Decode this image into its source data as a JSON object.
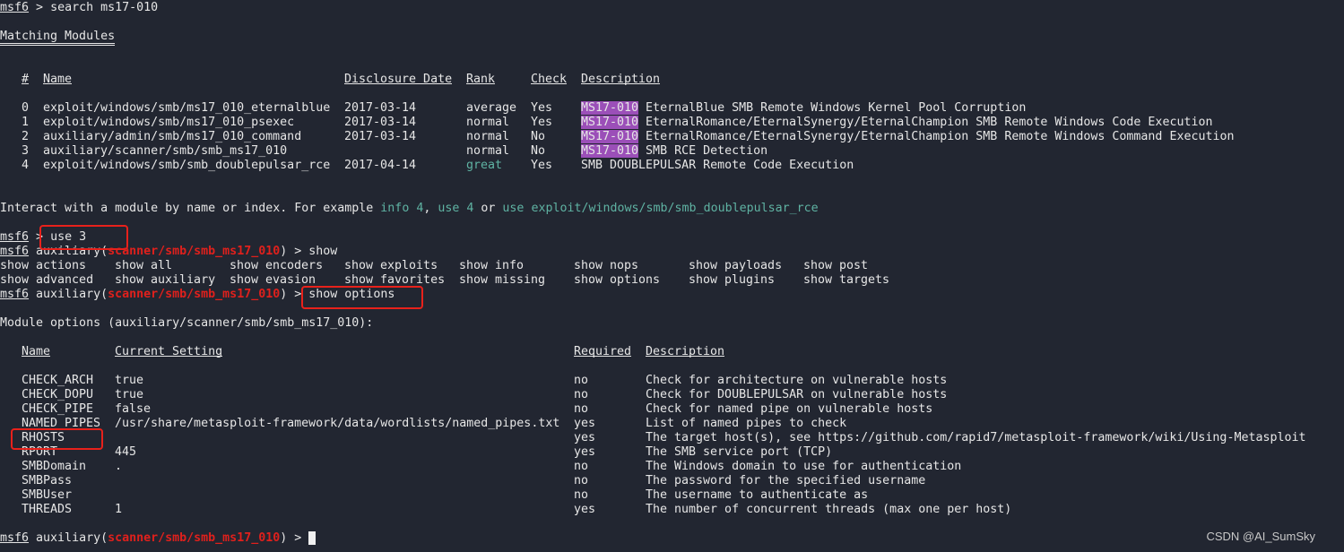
{
  "prompt": "msf6",
  "search_cmd": "search ms17-010",
  "matching_title": "Matching Modules",
  "modules_headers": [
    "#",
    "Name",
    "Disclosure Date",
    "Rank",
    "Check",
    "Description"
  ],
  "modules": [
    {
      "idx": "0",
      "name": "exploit/windows/smb/ms17_010_eternalblue",
      "date": "2017-03-14",
      "rank": "average",
      "check": "Yes",
      "tag": "MS17-010",
      "desc": " EternalBlue SMB Remote Windows Kernel Pool Corruption"
    },
    {
      "idx": "1",
      "name": "exploit/windows/smb/ms17_010_psexec",
      "date": "2017-03-14",
      "rank": "normal",
      "check": "Yes",
      "tag": "MS17-010",
      "desc": " EternalRomance/EternalSynergy/EternalChampion SMB Remote Windows Code Execution"
    },
    {
      "idx": "2",
      "name": "auxiliary/admin/smb/ms17_010_command",
      "date": "2017-03-14",
      "rank": "normal",
      "check": "No",
      "tag": "MS17-010",
      "desc": " EternalRomance/EternalSynergy/EternalChampion SMB Remote Windows Command Execution"
    },
    {
      "idx": "3",
      "name": "auxiliary/scanner/smb/smb_ms17_010",
      "date": "",
      "rank": "normal",
      "check": "No",
      "tag": "MS17-010",
      "desc": " SMB RCE Detection"
    },
    {
      "idx": "4",
      "name": "exploit/windows/smb/smb_doublepulsar_rce",
      "date": "2017-04-14",
      "rank": "great",
      "check": "Yes",
      "tag": "",
      "desc": "SMB DOUBLEPULSAR Remote Code Execution"
    }
  ],
  "interact": {
    "pre": "Interact with a module by name or index. For example ",
    "a": "info 4",
    "sep1": ", ",
    "b": "use 4",
    "sep2": " or ",
    "c": "use exploit/windows/smb/smb_doublepulsar_rce"
  },
  "use_cmd": "use 3",
  "module_path": "scanner/smb/smb_ms17_010",
  "aux_prefix": " auxiliary(",
  "aux_suffix": ") > ",
  "show_cmd": "show",
  "show_options_cmd": "show options",
  "show_row1": [
    "show actions",
    "show all",
    "show encoders",
    "show exploits",
    "show info",
    "show nops",
    "show payloads",
    "show post"
  ],
  "show_row2": [
    "show advanced",
    "show auxiliary",
    "show evasion",
    "show favorites",
    "show missing",
    "show options",
    "show plugins",
    "show targets"
  ],
  "module_options_title": "Module options (auxiliary/scanner/smb/smb_ms17_010):",
  "options_headers": [
    "Name",
    "Current Setting",
    "Required",
    "Description"
  ],
  "options": [
    {
      "name": "CHECK_ARCH",
      "value": "true",
      "req": "no",
      "desc": "Check for architecture on vulnerable hosts"
    },
    {
      "name": "CHECK_DOPU",
      "value": "true",
      "req": "no",
      "desc": "Check for DOUBLEPULSAR on vulnerable hosts"
    },
    {
      "name": "CHECK_PIPE",
      "value": "false",
      "req": "no",
      "desc": "Check for named pipe on vulnerable hosts"
    },
    {
      "name": "NAMED_PIPES",
      "value": "/usr/share/metasploit-framework/data/wordlists/named_pipes.txt",
      "req": "yes",
      "desc": "List of named pipes to check"
    },
    {
      "name": "RHOSTS",
      "value": "",
      "req": "yes",
      "desc": "The target host(s), see https://github.com/rapid7/metasploit-framework/wiki/Using-Metasploit"
    },
    {
      "name": "RPORT",
      "value": "445",
      "req": "yes",
      "desc": "The SMB service port (TCP)"
    },
    {
      "name": "SMBDomain",
      "value": ".",
      "req": "no",
      "desc": "The Windows domain to use for authentication"
    },
    {
      "name": "SMBPass",
      "value": "",
      "req": "no",
      "desc": "The password for the specified username"
    },
    {
      "name": "SMBUser",
      "value": "",
      "req": "no",
      "desc": "The username to authenticate as"
    },
    {
      "name": "THREADS",
      "value": "1",
      "req": "yes",
      "desc": "The number of concurrent threads (max one per host)"
    }
  ],
  "watermark": "CSDN @AI_SumSky",
  "colors": {
    "background": "#222631",
    "module_path": "#e0201c",
    "hint": "#5fb3a3",
    "highlight": "#9b4fb8",
    "annotation_box": "#e8211b"
  }
}
